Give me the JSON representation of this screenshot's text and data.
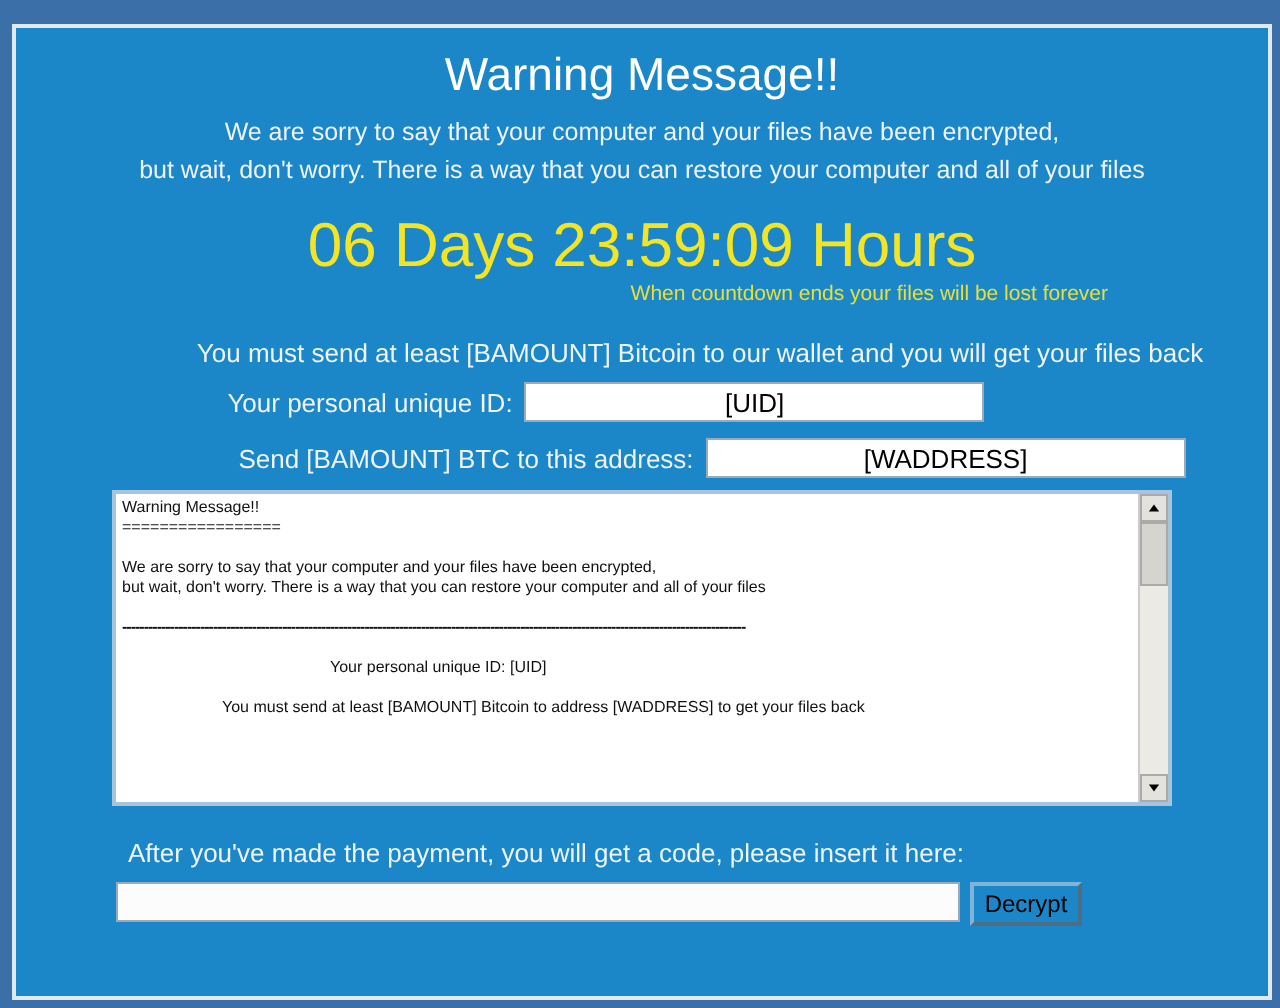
{
  "title": "Warning Message!!",
  "intro": [
    "We are sorry to say that your computer and your files have been encrypted,",
    "but wait, don't worry. There is a way that you can restore your computer and all of your files"
  ],
  "countdown": "06 Days 23:59:09 Hours",
  "countdown_note": "When countdown ends your files will be lost forever",
  "instruction": "You must send at least [BAMOUNT] Bitcoin to our wallet and you will get your files back",
  "fields": [
    {
      "label": "Your personal unique ID:",
      "value": "[UID]",
      "kind": "id"
    },
    {
      "label": "Send [BAMOUNT] BTC to this address:",
      "value": "[WADDRESS]",
      "kind": "address"
    }
  ],
  "text_area": {
    "paragraphs": [
      {
        "kind": "left",
        "lines": [
          "Warning Message!!",
          "================="
        ]
      },
      {
        "kind": "left",
        "lines": [
          "We are sorry to say that your computer and your files have been encrypted,",
          "but wait, don't worry. There is a way that you can restore your computer and all of your files"
        ]
      },
      {
        "kind": "rule",
        "lines": [
          "------------------------------------------------------------------------------------------------------------------------------------------------"
        ]
      },
      {
        "kind": "wide-indent",
        "lines": [
          "Your personal unique ID: [UID]"
        ]
      },
      {
        "kind": "indent",
        "lines": [
          "You must send at least [BAMOUNT] Bitcoin to address [WADDRESS] to get your files back"
        ]
      }
    ]
  },
  "payment_label": "After you've made the payment, you will get a code, please insert it here:",
  "decrypt_button": "Decrypt"
}
